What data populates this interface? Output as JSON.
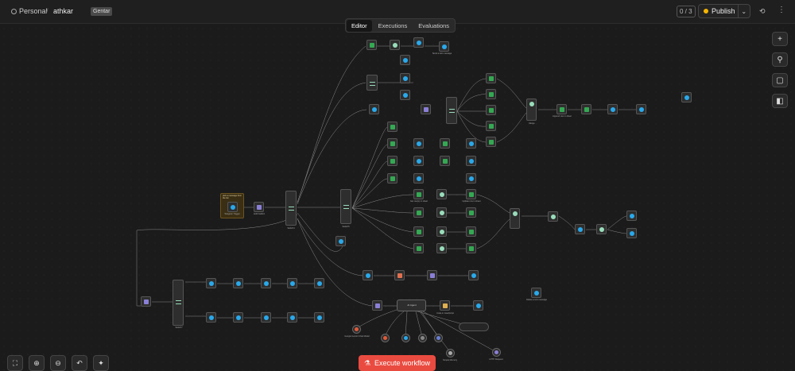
{
  "header": {
    "breadcrumb_project": "Personal",
    "breadcrumb_separator": "/",
    "workflow_name": "athkar",
    "tag": "Gentar",
    "version_counter": "0 / 3",
    "publish_label": "Publish"
  },
  "tabs": [
    {
      "label": "Editor",
      "active": true
    },
    {
      "label": "Executions",
      "active": false
    },
    {
      "label": "Evaluations",
      "active": false
    }
  ],
  "canvas": {
    "sticky_note": "pick a message from the list",
    "trigger_label": "Telegram Trigger",
    "agent_label": "AI Agent",
    "node_labels": {
      "edit_fields": "Edit Fields3",
      "switch_main": "Switch4",
      "switch_2": "Switch5",
      "switch_bottom": "Switch7",
      "send_text": "Send a text message",
      "get_rows": "Get row(s) in sheet",
      "append_row": "Append row in sheet",
      "update_row": "Update row in sheet",
      "merge": "Merge",
      "code": "Code in JavaScript",
      "chat_model": "Google Gemini Chat Model",
      "memory": "Simple Memory",
      "http": "HTTP Request",
      "delete_msg": "Delete a text message",
      "wait": "Wait"
    }
  },
  "toolbar": {
    "execute_label": "Execute workflow"
  },
  "icons": {
    "right": [
      "plus-icon",
      "search-icon",
      "sticky-note-icon",
      "panel-icon"
    ],
    "bottom": [
      "fit-view-icon",
      "zoom-in-icon",
      "zoom-out-icon",
      "undo-icon",
      "tidy-icon"
    ]
  },
  "colors": {
    "accent": "#ea4b40",
    "telegram": "#29a9eb",
    "sheets": "#34a853",
    "publish_dot": "#f4b400",
    "canvas": "#1b1b1b"
  }
}
